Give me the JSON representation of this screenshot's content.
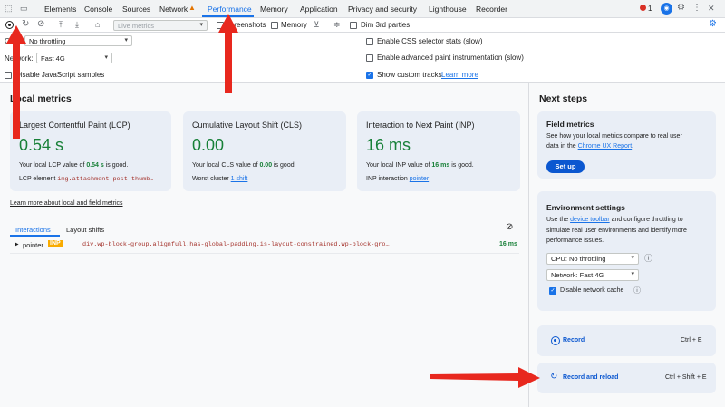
{
  "tabs": [
    {
      "label": "Elements"
    },
    {
      "label": "Console"
    },
    {
      "label": "Sources"
    },
    {
      "label": "Network"
    },
    {
      "label": "Performance"
    },
    {
      "label": "Memory"
    },
    {
      "label": "Application"
    },
    {
      "label": "Privacy and security"
    },
    {
      "label": "Lighthouse"
    },
    {
      "label": "Recorder"
    }
  ],
  "status": {
    "error_count": "1"
  },
  "toolbar": {
    "live_metrics_placeholder": "Live metrics",
    "screenshots_label": "Screenshots",
    "memory_label": "Memory",
    "dim_label": "Dim 3rd parties"
  },
  "settings": {
    "cpu_label": "CPU:",
    "cpu_value": "No throttling",
    "network_label": "Network:",
    "network_value": "Fast 4G",
    "disable_js_label": "Disable JavaScript samples",
    "css_stats_label": "Enable CSS selector stats (slow)",
    "paint_label": "Enable advanced paint instrumentation (slow)",
    "custom_tracks_label": "Show custom tracks",
    "learn_more": "Learn more"
  },
  "local": {
    "title": "Local metrics",
    "learn_more_link": "Learn more about local and field metrics",
    "cards": [
      {
        "title": "Largest Contentful Paint (LCP)",
        "value": "0.54 s",
        "desc_pre": "Your local LCP value of ",
        "desc_val": "0.54 s",
        "desc_post": " is good.",
        "extra_label": "LCP element",
        "extra_value": "img.attachment-post-thumb…"
      },
      {
        "title": "Cumulative Layout Shift (CLS)",
        "value": "0.00",
        "desc_pre": "Your local CLS value of ",
        "desc_val": "0.00",
        "desc_post": " is good.",
        "extra_label": "Worst cluster",
        "extra_value": "1 shift"
      },
      {
        "title": "Interaction to Next Paint (INP)",
        "value": "16 ms",
        "desc_pre": "Your local INP value of ",
        "desc_val": "16 ms",
        "desc_post": " is good.",
        "extra_label": "INP interaction",
        "extra_value": "pointer"
      }
    ],
    "subtabs": [
      "Interactions",
      "Layout shifts"
    ],
    "row": {
      "type": "pointer",
      "badge": "INP",
      "selector": "div.wp-block-group.alignfull.has-global-padding.is-layout-constrained.wp-block-gro…",
      "duration": "16 ms"
    }
  },
  "next": {
    "title": "Next steps",
    "field_title": "Field metrics",
    "field_desc1": "See how your local metrics compare to real user",
    "field_desc2_pre": "data in the ",
    "field_link": "Chrome UX Report",
    "field_desc2_post": ".",
    "setup_label": "Set up",
    "env_title": "Environment settings",
    "env_desc1_pre": "Use the ",
    "env_desc1_link": "device toolbar",
    "env_desc1_post": " and configure throttling to",
    "env_desc2": "simulate real user environments and identify more",
    "env_desc3": "performance issues.",
    "cpu_select": "CPU: No throttling",
    "net_select": "Network: Fast 4G",
    "disable_cache": "Disable network cache",
    "record_label": "Record",
    "record_shortcut": "Ctrl + E",
    "reload_label": "Record and reload",
    "reload_shortcut": "Ctrl + Shift + E"
  },
  "colors": {
    "accent": "#1a73e8",
    "good": "#188038",
    "arrow": "#e8281e",
    "card": "#e9eef6"
  }
}
